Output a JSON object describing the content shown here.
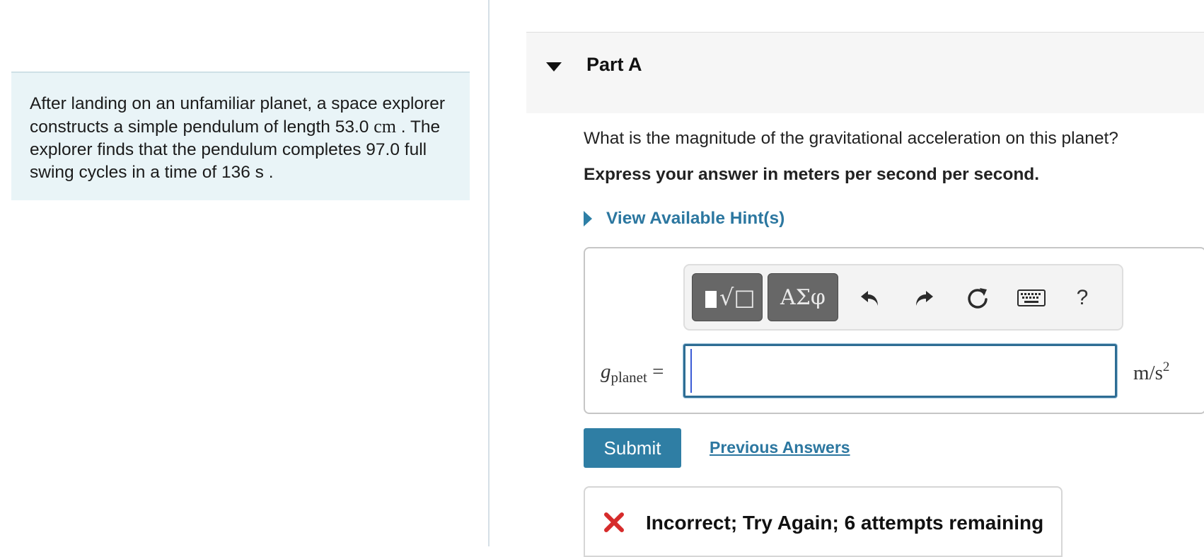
{
  "problem": {
    "text_1": "After landing on an unfamiliar planet, a space explorer constructs a simple pendulum of length",
    "length_value": "53.0",
    "length_unit": "cm",
    "text_2": ". The explorer finds that the pendulum completes 97.0 full swing cycles in a time of 136",
    "time_unit": "s",
    "text_3": "."
  },
  "part": {
    "title": "Part A",
    "question": "What is the magnitude of the gravitational acceleration on this planet?",
    "instruction": "Express your answer in meters per second per second.",
    "hint_label": "View Available Hint(s)"
  },
  "answer": {
    "variable": "g",
    "variable_subscript": "planet",
    "equals": "=",
    "value": "",
    "unit_base": "m/s",
    "unit_power": "2"
  },
  "toolbar": {
    "symbols_label": "ΑΣφ",
    "sqrt_label": "√□",
    "help_label": "?",
    "icons": [
      "templates-icon",
      "symbols-icon",
      "undo-icon",
      "redo-icon",
      "reset-icon",
      "keyboard-icon",
      "help-icon"
    ]
  },
  "actions": {
    "submit_label": "Submit",
    "previous_answers_label": "Previous Answers"
  },
  "feedback": {
    "text": "Incorrect; Try Again; 6 attempts remaining",
    "status_color": "#d62b2b"
  },
  "colors": {
    "accent": "#2f7ea4",
    "link": "#2c77a0",
    "problem_bg": "#e9f4f7"
  }
}
